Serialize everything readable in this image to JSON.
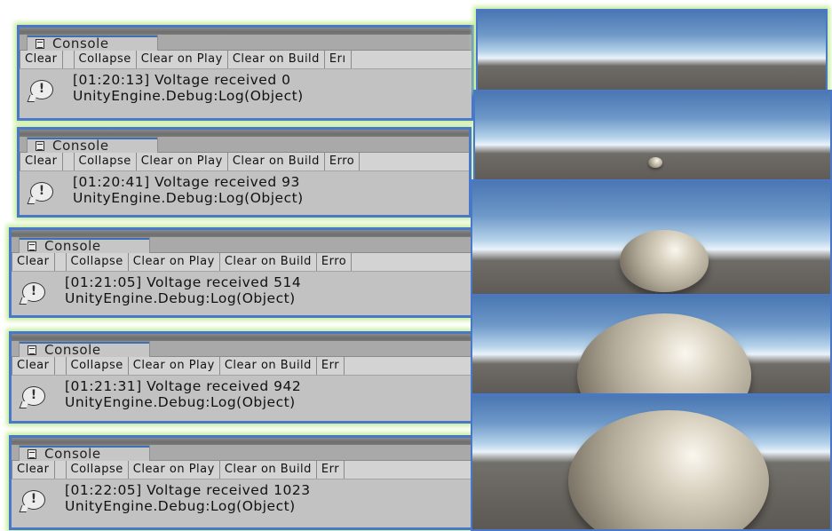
{
  "consoles": [
    {
      "tab_label": "Console",
      "toolbar": {
        "clear": "Clear",
        "collapse": "Collapse",
        "clear_on_play": "Clear on Play",
        "clear_on_build": "Clear on Build",
        "error_pause": "Erı"
      },
      "log": {
        "message": "[01:20:13] Voltage received 0",
        "source": "UnityEngine.Debug:Log(Object)",
        "icon": "info-icon"
      }
    },
    {
      "tab_label": "Console",
      "toolbar": {
        "clear": "Clear",
        "collapse": "Collapse",
        "clear_on_play": "Clear on Play",
        "clear_on_build": "Clear on Build",
        "error_pause": "Erro"
      },
      "log": {
        "message": "[01:20:41] Voltage received 93",
        "source": "UnityEngine.Debug:Log(Object)",
        "icon": "info-icon"
      }
    },
    {
      "tab_label": "Console",
      "toolbar": {
        "clear": "Clear",
        "collapse": "Collapse",
        "clear_on_play": "Clear on Play",
        "clear_on_build": "Clear on Build",
        "error_pause": "Erro"
      },
      "log": {
        "message": "[01:21:05] Voltage received 514",
        "source": "UnityEngine.Debug:Log(Object)",
        "icon": "info-icon"
      }
    },
    {
      "tab_label": "Console",
      "toolbar": {
        "clear": "Clear",
        "collapse": "Collapse",
        "clear_on_play": "Clear on Play",
        "clear_on_build": "Clear on Build",
        "error_pause": "Err"
      },
      "log": {
        "message": "[01:21:31] Voltage received 942",
        "source": "UnityEngine.Debug:Log(Object)",
        "icon": "info-icon"
      }
    },
    {
      "tab_label": "Console",
      "toolbar": {
        "clear": "Clear",
        "collapse": "Collapse",
        "clear_on_play": "Clear on Play",
        "clear_on_build": "Clear on Build",
        "error_pause": "Err"
      },
      "log": {
        "message": "[01:22:05] Voltage received 1023",
        "source": "UnityEngine.Debug:Log(Object)",
        "icon": "info-icon"
      }
    }
  ],
  "scenes": [
    {
      "object": "none"
    },
    {
      "object": "sphere"
    },
    {
      "object": "sphere"
    },
    {
      "object": "sphere"
    },
    {
      "object": "sphere"
    }
  ],
  "colors": {
    "panel_border": "#4a78c8",
    "panel_glow": "#c6ee9e",
    "console_bg": "#c2c2c2"
  }
}
